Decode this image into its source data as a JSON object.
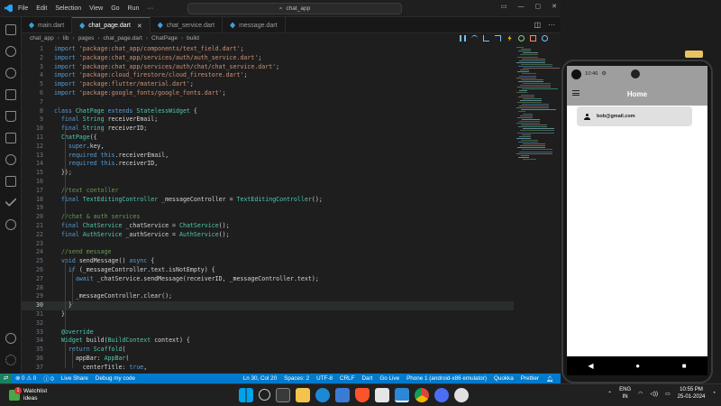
{
  "titlebar": {
    "menu": [
      "File",
      "Edit",
      "Selection",
      "View",
      "Go",
      "Run",
      "···"
    ],
    "search": "chat_app"
  },
  "tabs": [
    {
      "label": "main.dart",
      "active": false
    },
    {
      "label": "chat_page.dart",
      "active": true
    },
    {
      "label": "chat_service.dart",
      "active": false
    },
    {
      "label": "message.dart",
      "active": false
    }
  ],
  "breadcrumb": [
    "chat_app",
    "lib",
    "pages",
    "chat_page.dart",
    "ChatPage",
    "build"
  ],
  "code_lines": [
    {
      "n": "1",
      "t": "import 'package:chat_app/components/text_field.dart';"
    },
    {
      "n": "2",
      "t": "import 'package:chat_app/services/auth/auth_service.dart';"
    },
    {
      "n": "3",
      "t": "import 'package:chat_app/services/auth/chat/chat_service.dart';"
    },
    {
      "n": "4",
      "t": "import 'package:cloud_firestore/cloud_firestore.dart';"
    },
    {
      "n": "5",
      "t": "import 'package:flutter/material.dart';"
    },
    {
      "n": "6",
      "t": "import 'package:google_fonts/google_fonts.dart';"
    },
    {
      "n": "7",
      "t": ""
    },
    {
      "n": "8",
      "t": "class ChatPage extends StatelessWidget {"
    },
    {
      "n": "9",
      "t": "  final String receiverEmail;"
    },
    {
      "n": "10",
      "t": "  final String receiverID;"
    },
    {
      "n": "11",
      "t": "  ChatPage({"
    },
    {
      "n": "12",
      "t": "    super.key,"
    },
    {
      "n": "13",
      "t": "    required this.receiverEmail,"
    },
    {
      "n": "14",
      "t": "    required this.receiverID,"
    },
    {
      "n": "15",
      "t": "  });"
    },
    {
      "n": "16",
      "t": ""
    },
    {
      "n": "17",
      "t": "  //text contoller"
    },
    {
      "n": "18",
      "t": "  final TextEditingController _messageController = TextEditingController();"
    },
    {
      "n": "19",
      "t": ""
    },
    {
      "n": "20",
      "t": "  //chat & auth services"
    },
    {
      "n": "21",
      "t": "  final ChatService _chatService = ChatService();"
    },
    {
      "n": "22",
      "t": "  final AuthService _authService = AuthService();"
    },
    {
      "n": "23",
      "t": ""
    },
    {
      "n": "24",
      "t": "  //send message"
    },
    {
      "n": "25",
      "t": "  void sendMessage() async {"
    },
    {
      "n": "26",
      "t": "    if (_messageController.text.isNotEmpty) {"
    },
    {
      "n": "27",
      "t": "      await _chatService.sendMessage(receiverID, _messageController.text);"
    },
    {
      "n": "28",
      "t": ""
    },
    {
      "n": "29",
      "t": "      _messageController.clear();"
    },
    {
      "n": "30",
      "t": "    }"
    },
    {
      "n": "31",
      "t": "  }"
    },
    {
      "n": "32",
      "t": ""
    },
    {
      "n": "33",
      "t": "  @override"
    },
    {
      "n": "34",
      "t": "  Widget build(BuildContext context) {"
    },
    {
      "n": "35",
      "t": "    return Scaffold("
    },
    {
      "n": "36",
      "t": "      appBar: AppBar("
    },
    {
      "n": "37",
      "t": "        centerTitle: true,"
    }
  ],
  "status": {
    "errors": "0",
    "warnings": "0",
    "info": "0",
    "live_share": "Live Share",
    "debug": "Debug my code",
    "position": "Ln 30, Col 20",
    "spaces": "Spaces: 2",
    "encoding": "UTF-8",
    "eol": "CRLF",
    "lang": "Dart",
    "golive": "Go Live",
    "device": "Phone 1 (android-x86 emulator)",
    "quokka": "Quokka",
    "prettier": "Prettier"
  },
  "phone": {
    "time": "10:46",
    "title": "Home",
    "user": "bob@gmail.com"
  },
  "taskbar": {
    "widget_title": "Watchlist",
    "widget_sub": "ideas",
    "badge": "1",
    "lang1": "ENG",
    "lang2": "IN",
    "time": "10:55 PM",
    "date": "25-01-2024"
  },
  "colors": {
    "keyword": "#569cd6",
    "type": "#4ec9b0",
    "string": "#ce9178",
    "comment": "#6a9955",
    "accent": "#007acc",
    "appbar": "#9e9e9e"
  }
}
